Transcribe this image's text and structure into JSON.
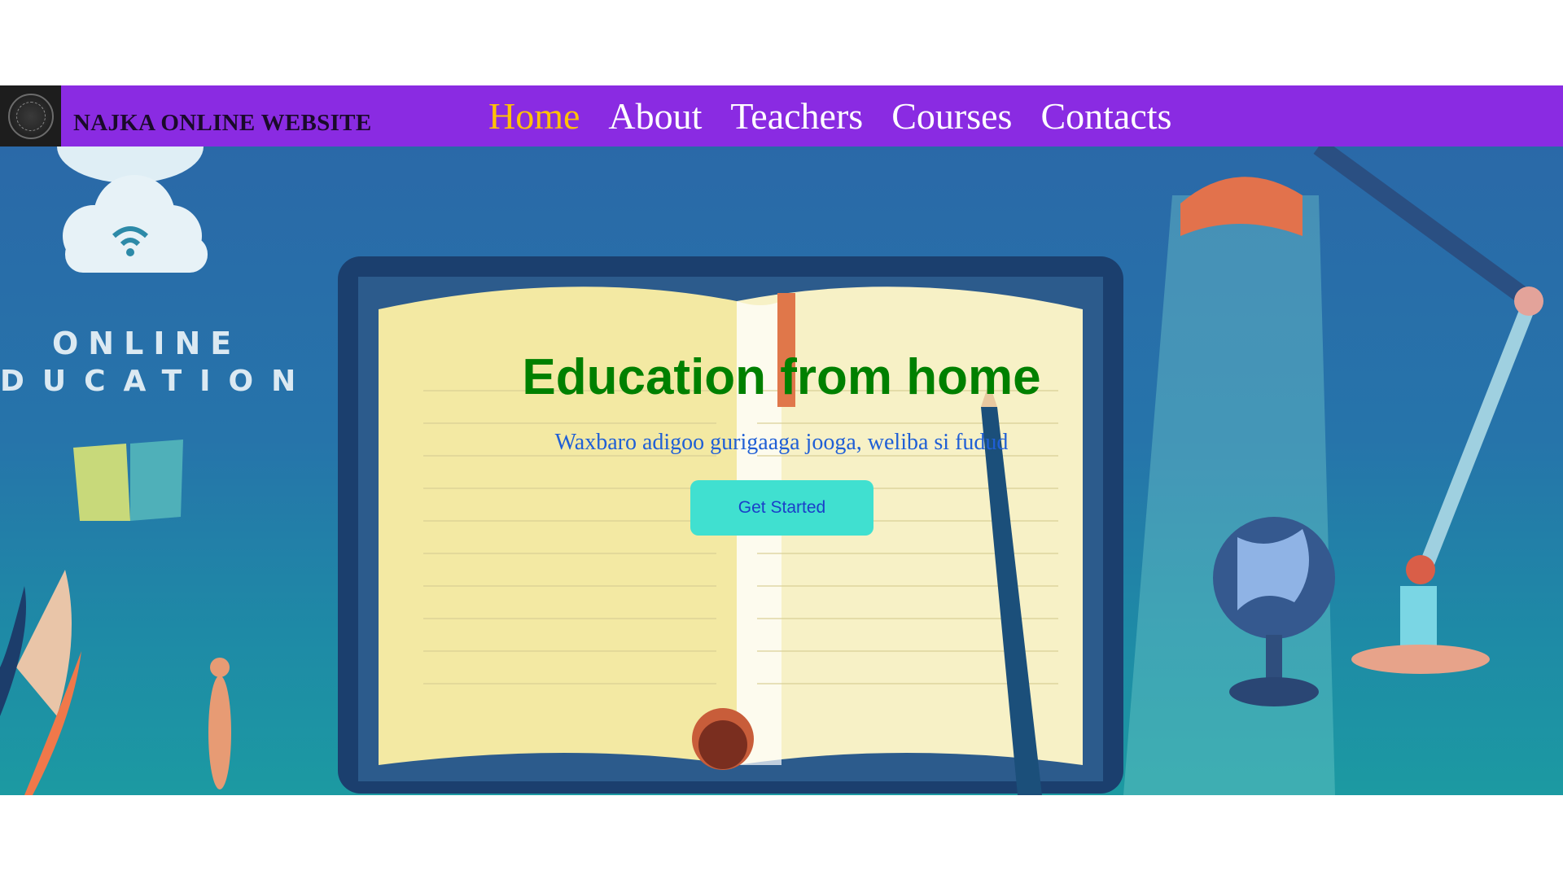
{
  "navbar": {
    "brand": "NAJKA ONLINE WEBSITE",
    "logo_icon": "school-seal-icon",
    "links": [
      {
        "label": "Home",
        "active": true
      },
      {
        "label": "About",
        "active": false
      },
      {
        "label": "Teachers",
        "active": false
      },
      {
        "label": "Courses",
        "active": false
      },
      {
        "label": "Contacts",
        "active": false
      }
    ]
  },
  "hero": {
    "image_text_line1": "ONLINE",
    "image_text_line2": "DUCATION",
    "title": "Education from home",
    "subtitle": "Waxbaro adigoo gurigaaga jooga, weliba si fudud",
    "cta_label": "Get Started"
  },
  "colors": {
    "navbar_bg": "#8a2be2",
    "active_link": "#ffc107",
    "title": "#008000",
    "subtitle": "#1f5fd6",
    "cta_bg": "#40e0d0"
  }
}
